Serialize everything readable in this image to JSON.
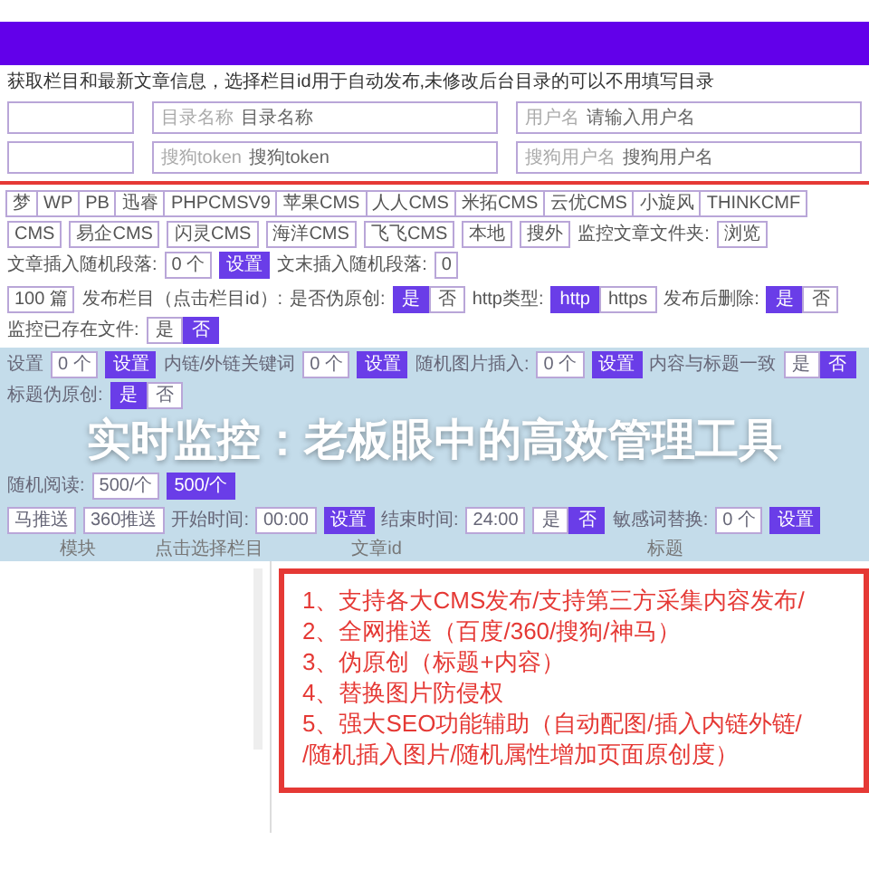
{
  "description": "获取栏目和最新文章信息，选择栏目id用于自动发布,未修改后台目录的可以不用填写目录",
  "field_rows": [
    {
      "fields": [
        {
          "kind": "blank"
        },
        {
          "kind": "labeled",
          "label": "目录名称",
          "placeholder": "目录名称"
        },
        {
          "kind": "labeled",
          "label": "用户名",
          "placeholder": "请输入用户名"
        }
      ]
    },
    {
      "fields": [
        {
          "kind": "blank"
        },
        {
          "kind": "labeled",
          "label": "搜狗token",
          "placeholder": "搜狗token"
        },
        {
          "kind": "labeled",
          "label": "搜狗用户名",
          "placeholder": "搜狗用户名"
        }
      ]
    }
  ],
  "cms_buttons": [
    "梦",
    "WP",
    "PB",
    "迅睿",
    "PHPCMSV9",
    "苹果CMS",
    "人人CMS",
    "米拓CMS",
    "云优CMS",
    "小旋风",
    "THINKCMF"
  ],
  "control_rows": [
    {
      "items": [
        {
          "kind": "button",
          "label": "CMS"
        },
        {
          "kind": "button",
          "label": "易企CMS"
        },
        {
          "kind": "button",
          "label": "闪灵CMS"
        },
        {
          "kind": "button",
          "label": "海洋CMS"
        },
        {
          "kind": "button",
          "label": "飞飞CMS"
        },
        {
          "kind": "button",
          "label": "本地"
        },
        {
          "kind": "button",
          "label": "搜外"
        },
        {
          "kind": "text",
          "label": "监控文章文件夹:"
        },
        {
          "kind": "button",
          "label": "浏览"
        },
        {
          "kind": "text",
          "label": "文章插入随机段落:"
        },
        {
          "kind": "input",
          "value": "0",
          "unit": "个"
        },
        {
          "kind": "action",
          "label": "设置"
        },
        {
          "kind": "text",
          "label": "文末插入随机段落:"
        },
        {
          "kind": "input",
          "value": "0"
        }
      ]
    },
    {
      "items": [
        {
          "kind": "input",
          "value": "100",
          "unit": "篇"
        },
        {
          "kind": "text",
          "label": "发布栏目（点击栏目id）:"
        },
        {
          "kind": "text",
          "label": "是否伪原创:"
        },
        {
          "kind": "toggle",
          "options": [
            {
              "label": "是",
              "selected": true
            },
            {
              "label": "否",
              "selected": false
            }
          ]
        },
        {
          "kind": "text",
          "label": "http类型:"
        },
        {
          "kind": "toggle",
          "options": [
            {
              "label": "http",
              "selected": true
            },
            {
              "label": "https",
              "selected": false
            }
          ]
        },
        {
          "kind": "text",
          "label": "发布后删除:"
        },
        {
          "kind": "toggle",
          "options": [
            {
              "label": "是",
              "selected": true
            },
            {
              "label": "否",
              "selected": false
            }
          ]
        },
        {
          "kind": "text",
          "label": "监控已存在文件:"
        },
        {
          "kind": "toggle",
          "options": [
            {
              "label": "是",
              "selected": false
            },
            {
              "label": "否",
              "selected": true
            }
          ]
        }
      ]
    }
  ],
  "tinted_rows_top": [
    {
      "items": [
        {
          "kind": "text",
          "label": "设置"
        },
        {
          "kind": "input",
          "value": "0",
          "unit": "个"
        },
        {
          "kind": "action",
          "label": "设置"
        },
        {
          "kind": "text",
          "label": "内链/外链关键词"
        },
        {
          "kind": "input",
          "value": "0",
          "unit": "个"
        },
        {
          "kind": "action",
          "label": "设置"
        },
        {
          "kind": "text",
          "label": "随机图片插入:"
        },
        {
          "kind": "input",
          "value": "0",
          "unit": "个"
        },
        {
          "kind": "action",
          "label": "设置"
        },
        {
          "kind": "text",
          "label": "内容与标题一致"
        },
        {
          "kind": "toggle",
          "options": [
            {
              "label": "是",
              "selected": false
            },
            {
              "label": "否",
              "selected": true
            }
          ]
        },
        {
          "kind": "text",
          "label": "标题伪原创:"
        },
        {
          "kind": "toggle",
          "options": [
            {
              "label": "是",
              "selected": true
            },
            {
              "label": "否",
              "selected": false
            }
          ]
        }
      ]
    }
  ],
  "banner_title": "实时监控：老板眼中的高效管理工具",
  "tinted_rows": [
    {
      "items": [
        {
          "kind": "text",
          "label": "随机阅读:"
        },
        {
          "kind": "button",
          "label": "500/个"
        },
        {
          "kind": "action",
          "label": "500/个"
        }
      ]
    },
    {
      "items": [
        {
          "kind": "button",
          "label": "马推送"
        },
        {
          "kind": "button",
          "label": "360推送"
        },
        {
          "kind": "text",
          "label": "开始时间:"
        },
        {
          "kind": "input",
          "value": "00:00"
        },
        {
          "kind": "action",
          "label": "设置"
        },
        {
          "kind": "text",
          "label": "结束时间:"
        },
        {
          "kind": "input",
          "value": "24:00"
        },
        {
          "kind": "toggle",
          "options": [
            {
              "label": "是",
              "selected": false
            },
            {
              "label": "否",
              "selected": true
            }
          ]
        },
        {
          "kind": "text",
          "label": "敏感词替换:"
        },
        {
          "kind": "input",
          "value": "0",
          "unit": "个"
        },
        {
          "kind": "action",
          "label": "设置"
        }
      ]
    }
  ],
  "table_columns": [
    "模块",
    "点击选择栏目",
    "文章id",
    "标题"
  ],
  "features": [
    "1、支持各大CMS发布/支持第三方采集内容发布/",
    "2、全网推送（百度/360/搜狗/神马）",
    "3、伪原创（标题+内容）",
    "4、替换图片防侵权",
    "5、强大SEO功能辅助（自动配图/插入内链外链/",
    "/随机插入图片/随机属性增加页面原创度）"
  ]
}
